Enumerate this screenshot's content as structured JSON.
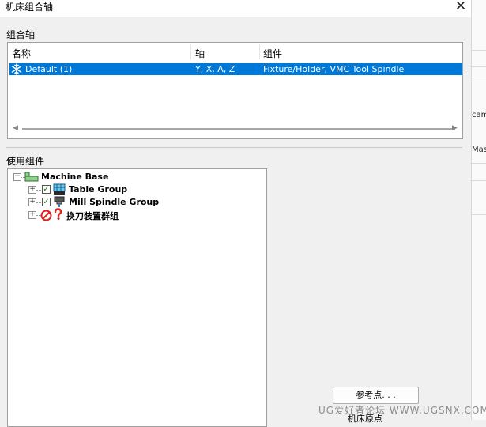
{
  "window": {
    "title": "机床组合轴"
  },
  "axis_group": {
    "label": "组合轴",
    "columns": [
      "名称",
      "轴",
      "组件"
    ],
    "rows": [
      {
        "name": "Default (1)",
        "axes": "Y, X, A, Z",
        "components": "Fixture/Holder, VMC Tool Spindle",
        "selected": true
      }
    ]
  },
  "components_section": {
    "label": "使用组件",
    "tree": {
      "root": "Machine Base",
      "children": [
        {
          "label": "Table Group",
          "checked": true
        },
        {
          "label": "Mill Spindle Group",
          "checked": true
        },
        {
          "label": "换刀装置群组",
          "checked": false,
          "status": "disabled-unknown"
        }
      ]
    }
  },
  "buttons": {
    "reference_point": "参考点. . ."
  },
  "partial_text": {
    "below_button": "机床原点"
  },
  "right_strip": {
    "text_1": "cam",
    "text_2": "Mas"
  },
  "watermark": "UG爱好者论坛 WWW.UGSNX.COM",
  "colors": {
    "selection": "#0078d7",
    "check": "#1a7a1a",
    "no_icon": "#e02020"
  }
}
